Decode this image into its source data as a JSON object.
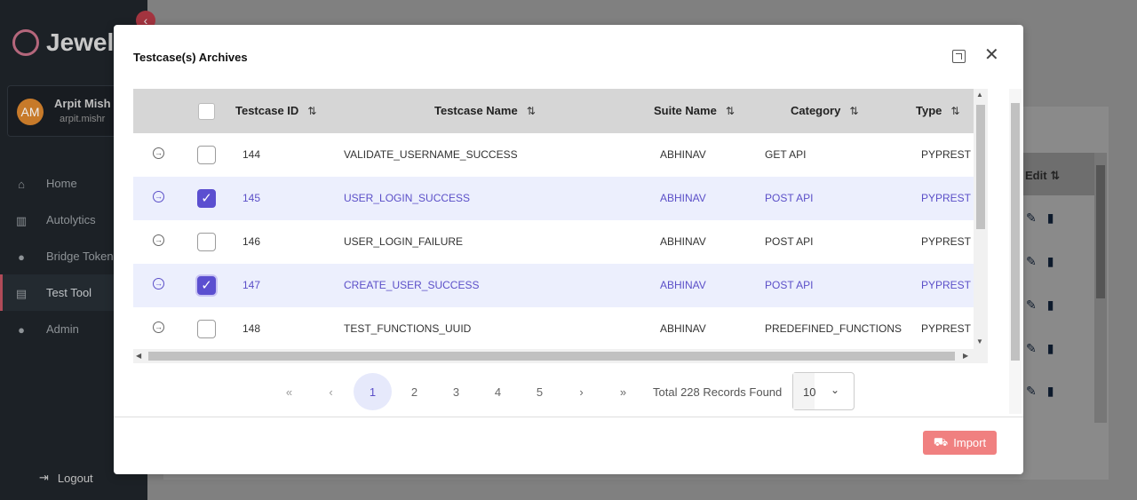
{
  "app": {
    "brand": "Jewel",
    "user": {
      "initials": "AM",
      "name": "Arpit Mish",
      "email": "arpit.mishr"
    },
    "nav": [
      {
        "label": "Home",
        "icon": "home-icon"
      },
      {
        "label": "Autolytics",
        "icon": "chart-icon"
      },
      {
        "label": "Bridge Token",
        "icon": "users-icon"
      },
      {
        "label": "Test Tool",
        "icon": "toolbox-icon"
      },
      {
        "label": "Admin",
        "icon": "user-icon"
      }
    ],
    "logout": "Logout",
    "bg_table": {
      "edit_header": "Edit"
    }
  },
  "modal": {
    "title": "Testcase(s) Archives",
    "columns": [
      "Testcase ID",
      "Testcase Name",
      "Suite Name",
      "Category",
      "Type"
    ],
    "rows": [
      {
        "id": "144",
        "name": "VALIDATE_USERNAME_SUCCESS",
        "suite": "ABHINAV",
        "category": "GET API",
        "type": "PYPREST",
        "selected": false
      },
      {
        "id": "145",
        "name": "USER_LOGIN_SUCCESS",
        "suite": "ABHINAV",
        "category": "POST API",
        "type": "PYPREST",
        "selected": true
      },
      {
        "id": "146",
        "name": "USER_LOGIN_FAILURE",
        "suite": "ABHINAV",
        "category": "POST API",
        "type": "PYPREST",
        "selected": false
      },
      {
        "id": "147",
        "name": "CREATE_USER_SUCCESS",
        "suite": "ABHINAV",
        "category": "POST API",
        "type": "PYPREST",
        "selected": true
      },
      {
        "id": "148",
        "name": "TEST_FUNCTIONS_UUID",
        "suite": "ABHINAV",
        "category": "PREDEFINED_FUNCTIONS",
        "type": "PYPREST",
        "selected": false
      }
    ],
    "pagination": {
      "first": "«",
      "prev": "‹",
      "next": "›",
      "last": "»",
      "pages": [
        "1",
        "2",
        "3",
        "4",
        "5"
      ],
      "current": "1",
      "records": "Total 228 Records Found",
      "page_size": "10"
    },
    "import_label": "Import"
  }
}
